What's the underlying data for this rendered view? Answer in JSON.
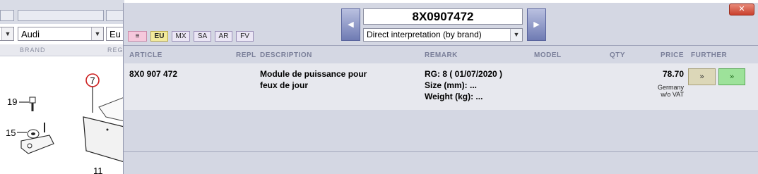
{
  "background": {
    "brand_value": "Audi",
    "region_value": "Eu",
    "brand_label": "BRAND",
    "region_label": "REG",
    "callouts": [
      "19",
      "15",
      "7",
      "11"
    ]
  },
  "search": {
    "value": "8X0907472",
    "interpretation": "Direct interpretation (by brand)",
    "prev_icon": "chevron-left-icon",
    "next_icon": "chevron-right-icon",
    "close_icon": "close-icon"
  },
  "regions": [
    {
      "label": "≡",
      "kind": "menu"
    },
    {
      "label": "EU",
      "kind": "active"
    },
    {
      "label": "MX",
      "kind": "normal"
    },
    {
      "label": "SA",
      "kind": "normal"
    },
    {
      "label": "AR",
      "kind": "normal"
    },
    {
      "label": "FV",
      "kind": "normal"
    }
  ],
  "table": {
    "headers": {
      "article": "ARTICLE",
      "repl": "REPL",
      "description": "DESCRIPTION",
      "remark": "REMARK",
      "model": "MODEL",
      "qty": "QTY",
      "price": "PRICE",
      "further": "FURTHER"
    },
    "rows": [
      {
        "article": "8X0 907 472",
        "description_line1": "Module de puissance pour",
        "description_line2": "feux de jour",
        "remark_line1": "RG: 8 ( 01/07/2020 )",
        "remark_line2": "Size (mm): ...",
        "remark_line3": "Weight (kg): ...",
        "price": "78.70",
        "price_note1": "Germany",
        "price_note2": "w/o VAT",
        "further_btn1": "»",
        "further_btn2": "»"
      }
    ]
  },
  "colors": {
    "popup_bg": "#d4d7e3",
    "row_bg": "#e7e8ee",
    "active_region": "#f2ea9c",
    "further_green": "#9de29a",
    "close_red": "#c9402d"
  }
}
